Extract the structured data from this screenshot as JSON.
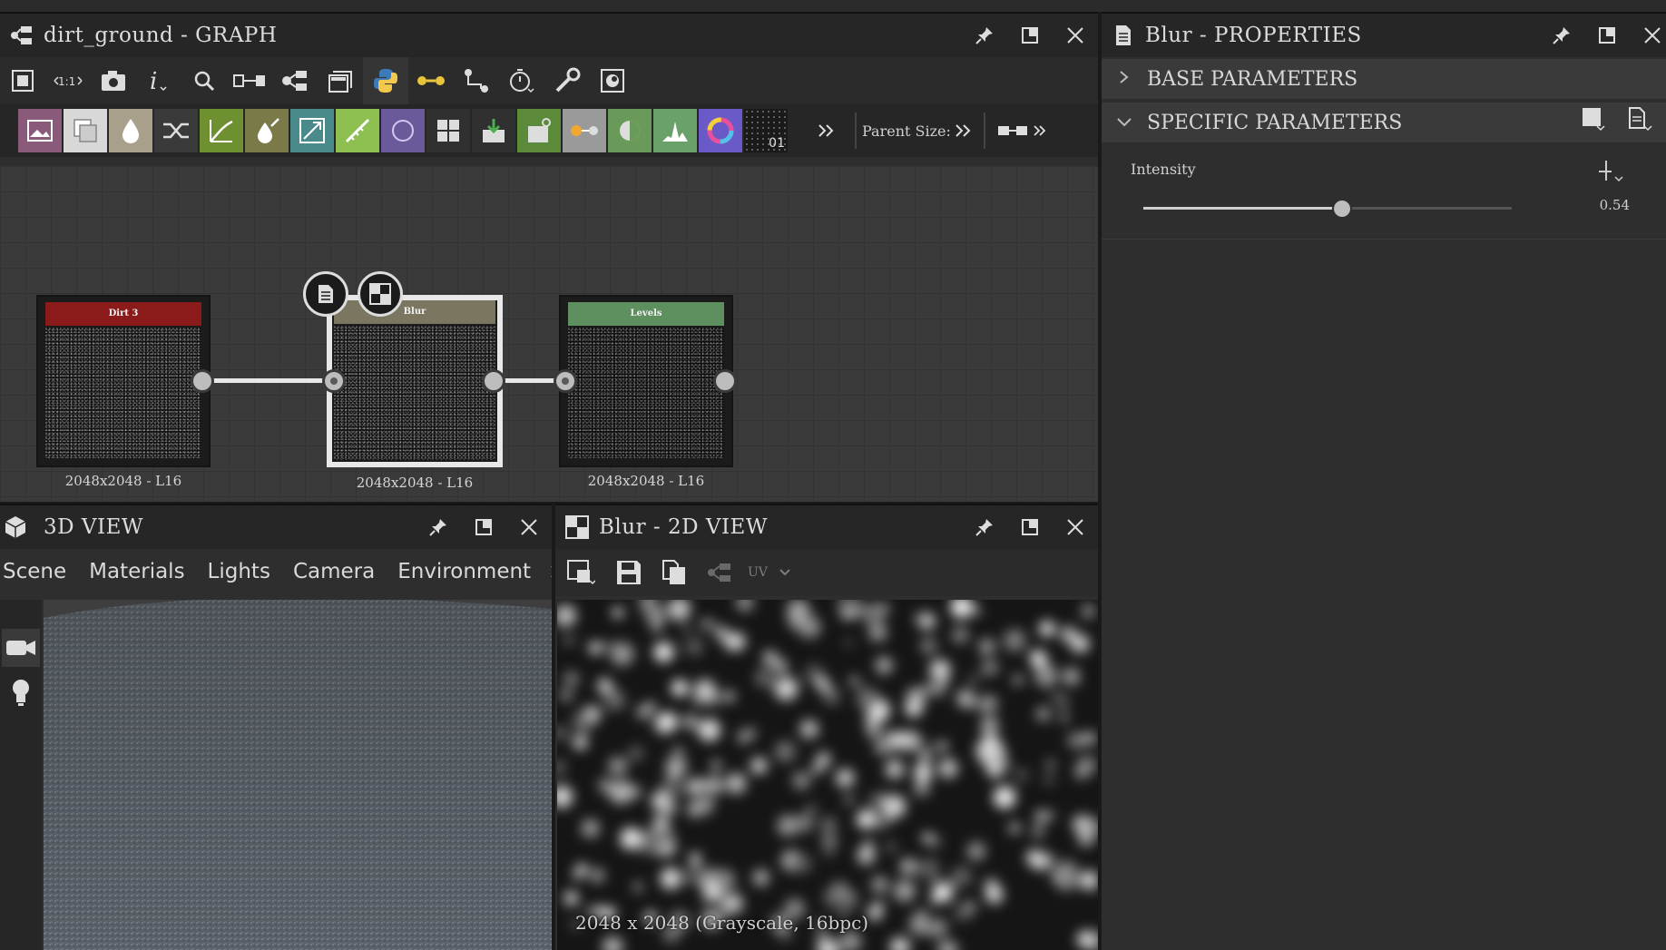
{
  "graph_panel": {
    "title": "dirt_ground - GRAPH",
    "parent_size_label": "Parent Size:",
    "nodes": [
      {
        "name": "Dirt 3",
        "caption": "2048x2048 - L16",
        "color": "#8b1a1a"
      },
      {
        "name": "Blur",
        "caption": "2048x2048 - L16",
        "color": "#7a7660"
      },
      {
        "name": "Levels",
        "caption": "2048x2048 - L16",
        "color": "#5e8f5e"
      }
    ],
    "node_strip_colors": [
      "#8a5a7a",
      "#d8d8d8",
      "#a8a08a",
      "#3a3a3a",
      "#6f9030",
      "#7a7a48",
      "#4a8a8a",
      "#8dc050",
      "#6a5a9a",
      "#303030",
      "#303030",
      "#5a8a3a",
      "#9a9a9a",
      "#6a9a5a",
      "#6aa06a",
      "#6a5ac8",
      "#1a1a1a"
    ],
    "strip_text_01": "01"
  },
  "properties_panel": {
    "title": "Blur - PROPERTIES",
    "sections": {
      "base": "BASE PARAMETERS",
      "specific": "SPECIFIC PARAMETERS"
    },
    "intensity": {
      "label": "Intensity",
      "value": "0.54",
      "fraction": 0.54
    }
  },
  "view3d_panel": {
    "title": "3D VIEW",
    "tabs": [
      "Scene",
      "Materials",
      "Lights",
      "Camera",
      "Environment"
    ]
  },
  "view2d_panel": {
    "title": "Blur - 2D VIEW",
    "uv_label": "UV",
    "info": "2048 x 2048 (Grayscale, 16bpc)"
  },
  "colors": {
    "accent_python": "#3c7ab8",
    "connector": "#e8c43a"
  }
}
